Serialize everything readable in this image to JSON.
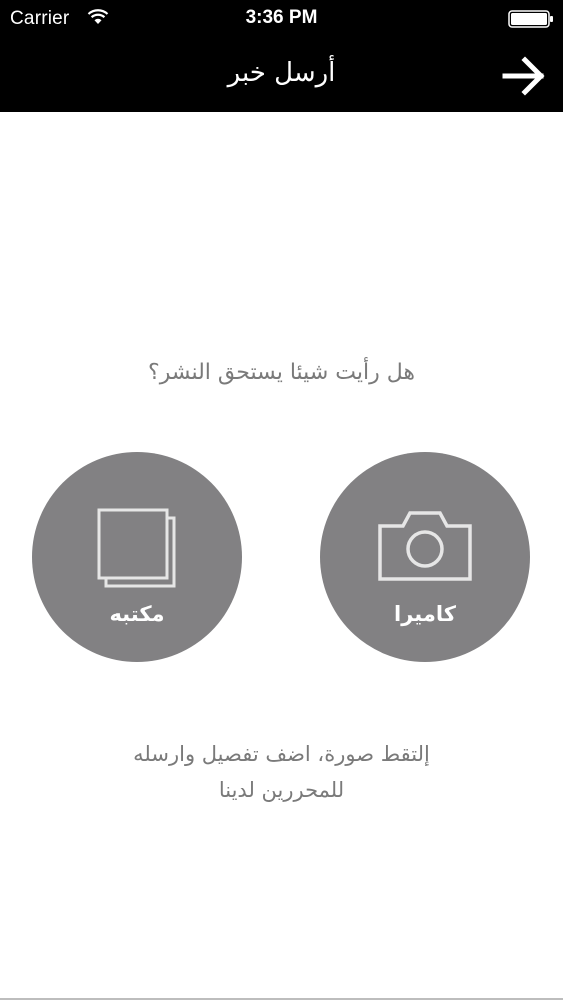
{
  "status_bar": {
    "carrier": "Carrier",
    "time": "3:36 PM",
    "wifi_icon": "wifi-icon",
    "battery_icon": "battery-icon"
  },
  "nav": {
    "title": "أرسل خبر",
    "back_icon": "arrow-right-icon"
  },
  "main": {
    "question": "هل رأيت شيئا يستحق النشر؟",
    "library_button": {
      "label": "مكتبه",
      "icon": "photo-library-icon"
    },
    "camera_button": {
      "label": "كاميرا",
      "icon": "camera-icon"
    },
    "description_line1": "إلتقط صورة، اضف تفصيل وارسله",
    "description_line2": "للمحررين لدينا"
  },
  "colors": {
    "bar_background": "#000000",
    "circle_fill": "#828183",
    "text_gray": "#7a7a7a"
  }
}
